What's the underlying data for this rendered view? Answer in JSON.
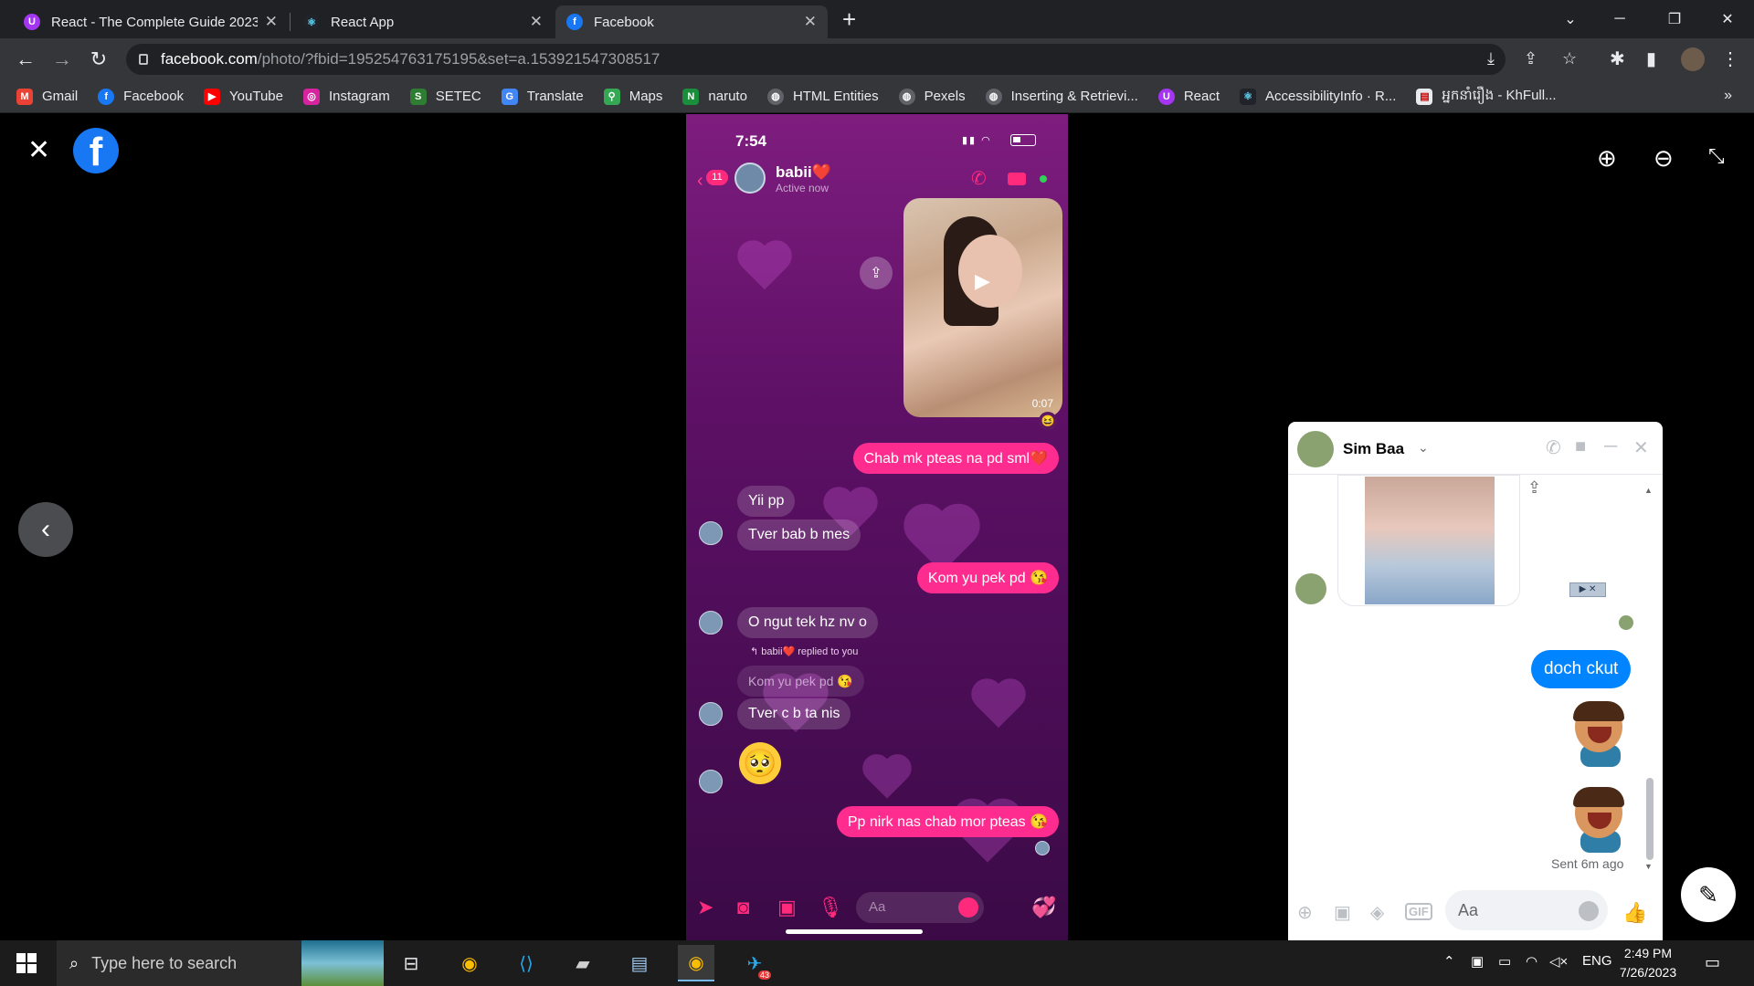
{
  "browser": {
    "tabs": [
      {
        "title": "React - The Complete Guide 2023",
        "icon": "udemy-icon",
        "color": "#a435f0"
      },
      {
        "title": "React App",
        "icon": "react-icon",
        "color": "#61dafb"
      },
      {
        "title": "Facebook",
        "icon": "facebook-icon",
        "color": "#1877f2"
      }
    ],
    "url_host": "facebook.com",
    "url_path": "/photo/?fbid=195254763175195&set=a.153921547308517",
    "bookmarks": [
      {
        "label": "Gmail",
        "icon": "gmail-icon",
        "color": "#ea4335"
      },
      {
        "label": "Facebook",
        "icon": "facebook-icon",
        "color": "#1877f2"
      },
      {
        "label": "YouTube",
        "icon": "youtube-icon",
        "color": "#ff0000"
      },
      {
        "label": "Instagram",
        "icon": "instagram-icon",
        "color": "#d6249f"
      },
      {
        "label": "SETEC",
        "icon": "setec-icon",
        "color": "#2e7d32"
      },
      {
        "label": "Translate",
        "icon": "translate-icon",
        "color": "#4285f4"
      },
      {
        "label": "Maps",
        "icon": "maps-icon",
        "color": "#34a853"
      },
      {
        "label": "naruto",
        "icon": "naruto-icon",
        "color": "#1b8e3c"
      },
      {
        "label": "HTML Entities",
        "icon": "globe-icon",
        "color": "#5f6368"
      },
      {
        "label": "Pexels",
        "icon": "globe-icon",
        "color": "#5f6368"
      },
      {
        "label": "Inserting & Retrievi...",
        "icon": "globe-icon",
        "color": "#5f6368"
      },
      {
        "label": "React",
        "icon": "udemy-icon",
        "color": "#a435f0"
      },
      {
        "label": "AccessibilityInfo · R...",
        "icon": "react-icon",
        "color": "#61dafb"
      },
      {
        "label": "អ្នកនាំរឿង - KhFull...",
        "icon": "page-icon",
        "color": "#e8eaed"
      }
    ]
  },
  "phone": {
    "time": "7:54",
    "contact": "babii❤️",
    "status": "Active now",
    "unread": "11",
    "video_duration": "0:07",
    "messages": [
      {
        "text": "Chab mk pteas na pd sml❤️",
        "from": "me"
      },
      {
        "text": "Yii pp",
        "from": "them"
      },
      {
        "text": "Tver bab b mes",
        "from": "them"
      },
      {
        "text": "Kom yu pek pd 😘",
        "from": "me"
      },
      {
        "text": "O ngut tek hz nv o",
        "from": "them"
      },
      {
        "text": "Tver c b ta nis",
        "from": "them"
      },
      {
        "text": "Pp nirk nas chab mor pteas 😘",
        "from": "me"
      }
    ],
    "reply_note": "↰ babii❤️ replied to you",
    "reply_quote": "Kom yu pek pd 😘",
    "big_emoji": "🥺",
    "input_placeholder": "Aa"
  },
  "chat": {
    "name": "Sim Baa",
    "my_message": "doch ckut",
    "sent_status": "Sent 6m ago",
    "input_placeholder": "Aa",
    "gif_label": "GIF"
  },
  "taskbar": {
    "search_placeholder": "Type here to search",
    "language": "ENG",
    "time": "2:49 PM",
    "date": "7/26/2023",
    "telegram_badge": "43"
  }
}
